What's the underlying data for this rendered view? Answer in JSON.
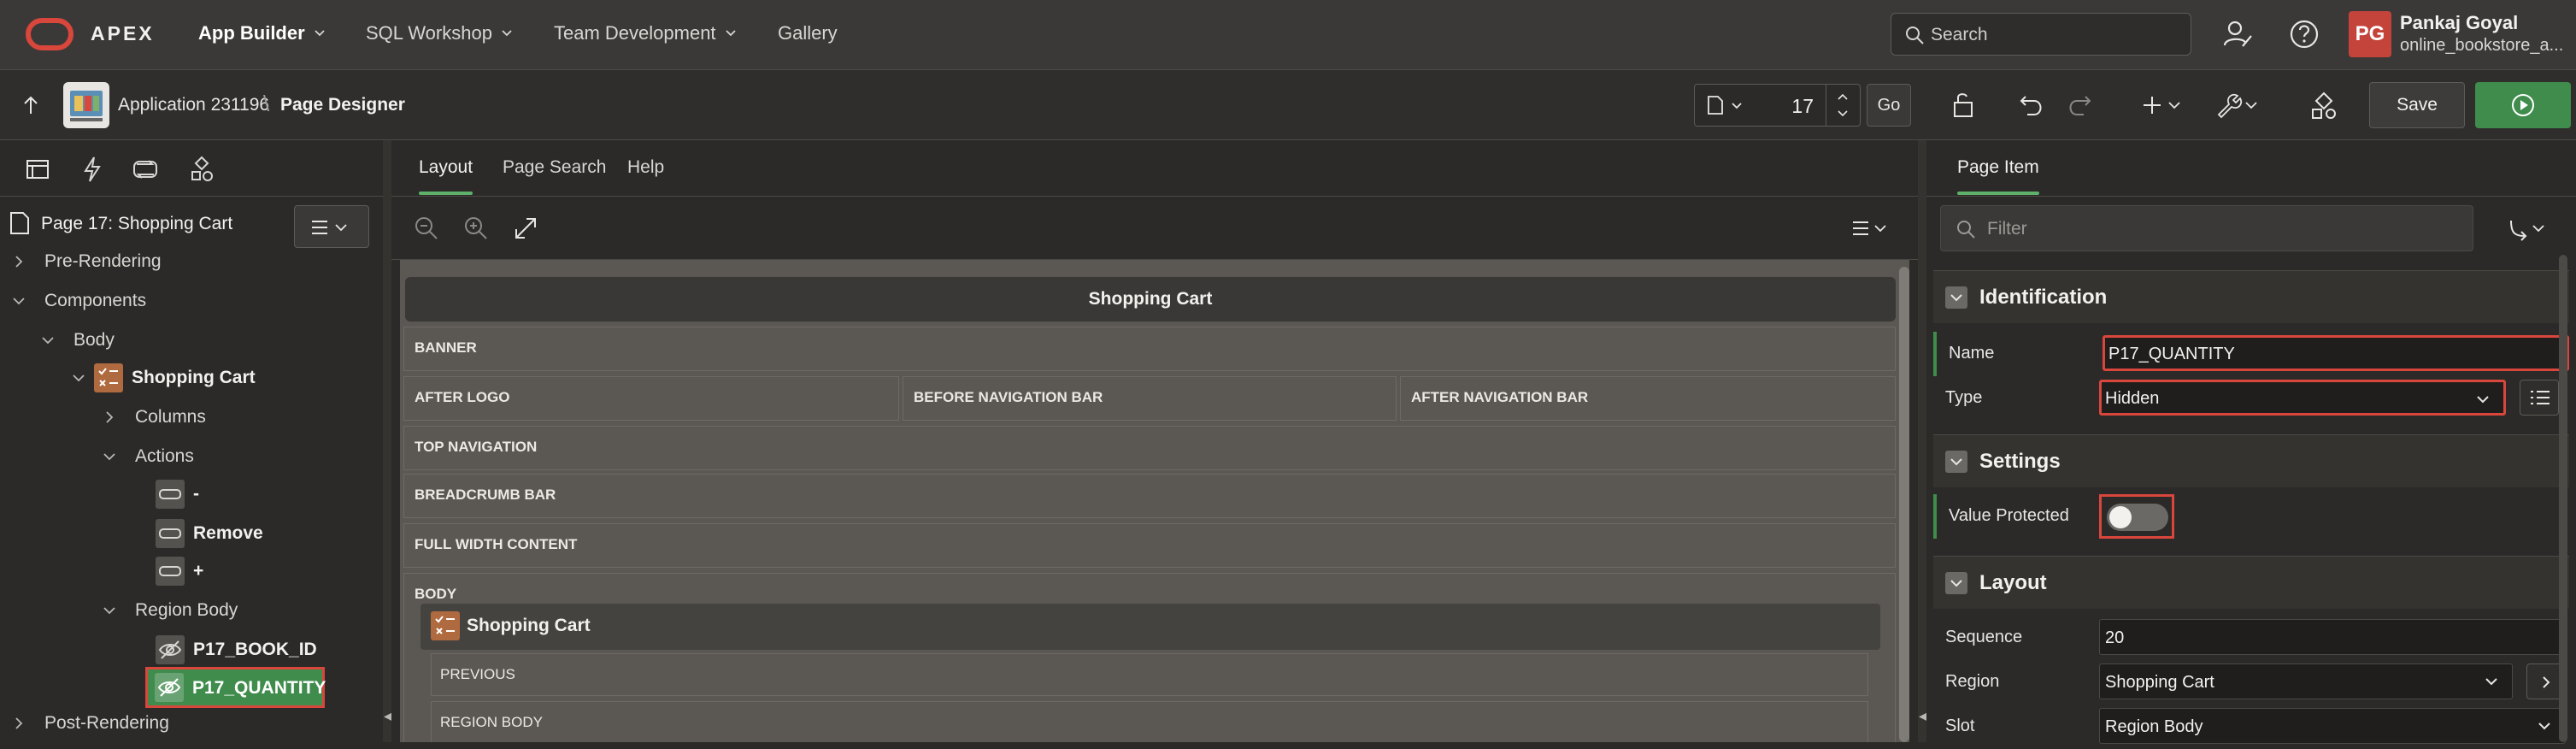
{
  "topnav": {
    "brand": "APEX",
    "menus": [
      {
        "label": "App Builder"
      },
      {
        "label": "SQL Workshop"
      },
      {
        "label": "Team Development"
      },
      {
        "label": "Gallery"
      }
    ],
    "search_placeholder": "Search",
    "user": {
      "initials": "PG",
      "name": "Pankaj Goyal",
      "app": "online_bookstore_a..."
    }
  },
  "toolbar": {
    "app_crumb": "Application 231196",
    "crumb_sep": "\\",
    "page_crumb": "Page Designer",
    "page_number": "17",
    "go_label": "Go",
    "save_label": "Save"
  },
  "leftpanel": {
    "page_title": "Page 17: Shopping Cart",
    "tree": [
      {
        "label": "Pre-Rendering"
      },
      {
        "label": "Components"
      },
      {
        "label": "Body"
      },
      {
        "label": "Shopping Cart"
      },
      {
        "label": "Columns"
      },
      {
        "label": "Actions"
      },
      {
        "label": "-"
      },
      {
        "label": "Remove"
      },
      {
        "label": "+"
      },
      {
        "label": "Region Body"
      },
      {
        "label": "P17_BOOK_ID"
      },
      {
        "label": "P17_QUANTITY"
      },
      {
        "label": "Post-Rendering"
      }
    ]
  },
  "center": {
    "tabs": [
      {
        "label": "Layout"
      },
      {
        "label": "Page Search"
      },
      {
        "label": "Help"
      }
    ],
    "canvas_title": "Shopping Cart",
    "slots": {
      "banner": "BANNER",
      "after_logo": "AFTER LOGO",
      "before_nav": "BEFORE NAVIGATION BAR",
      "after_nav": "AFTER NAVIGATION BAR",
      "top_nav": "TOP NAVIGATION",
      "breadcrumb": "BREADCRUMB BAR",
      "full_width": "FULL WIDTH CONTENT",
      "body": "BODY"
    },
    "region": {
      "title": "Shopping Cart",
      "previous": "PREVIOUS",
      "region_body": "REGION BODY"
    }
  },
  "rightpanel": {
    "tab": "Page Item",
    "filter_placeholder": "Filter",
    "identification": {
      "title": "Identification",
      "name_label": "Name",
      "name_value": "P17_QUANTITY",
      "type_label": "Type",
      "type_value": "Hidden"
    },
    "settings": {
      "title": "Settings",
      "value_protected_label": "Value Protected",
      "value_protected": false
    },
    "layout": {
      "title": "Layout",
      "sequence_label": "Sequence",
      "sequence_value": "20",
      "region_label": "Region",
      "region_value": "Shopping Cart",
      "slot_label": "Slot",
      "slot_value": "Region Body"
    }
  },
  "colors": {
    "accent_green": "#3f8c4c",
    "highlight_red": "#d8463c",
    "brand_red": "#c4443c"
  }
}
